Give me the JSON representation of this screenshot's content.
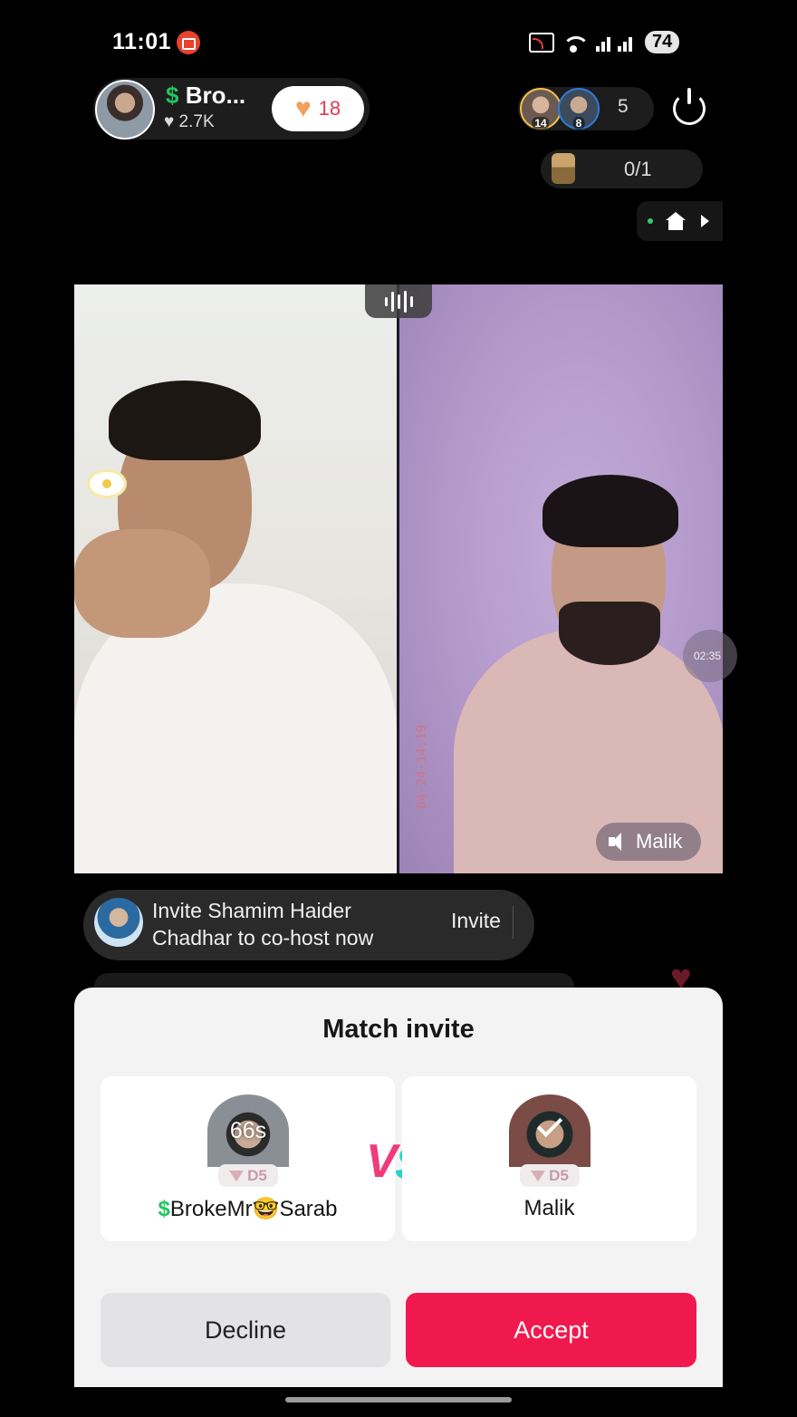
{
  "status_bar": {
    "time": "11:01",
    "battery": "74",
    "icons": [
      "record-icon",
      "cast-icon",
      "wifi-icon",
      "signal-icon",
      "battery-icon"
    ]
  },
  "host": {
    "name": "Bro...",
    "name_prefix": "$",
    "likes": "♥ 2.7K",
    "like_count": "18"
  },
  "viewers": {
    "ranks": [
      "14",
      "8"
    ],
    "count": "5"
  },
  "cohost": {
    "count": "0/1"
  },
  "video": {
    "timestamp": "04-24-14:19",
    "side_timer": "02:35",
    "right_speaker": "Malik"
  },
  "invite_banner": {
    "text": "Invite Shamim Haider Chadhar to co-host now",
    "button": "Invite"
  },
  "match_invite": {
    "title": "Match invite",
    "left": {
      "countdown": "66s",
      "level": "D5",
      "name": "BrokeMr🤓Sarab",
      "name_prefix": "$"
    },
    "right": {
      "level": "D5",
      "name": "Malik"
    },
    "vs_v": "V",
    "vs_s": "S",
    "decline": "Decline",
    "accept": "Accept"
  },
  "colors": {
    "accent": "#f0194d",
    "dollar": "#22c55e",
    "vs_pink": "#f03a7a",
    "vs_teal": "#27d3c6"
  }
}
